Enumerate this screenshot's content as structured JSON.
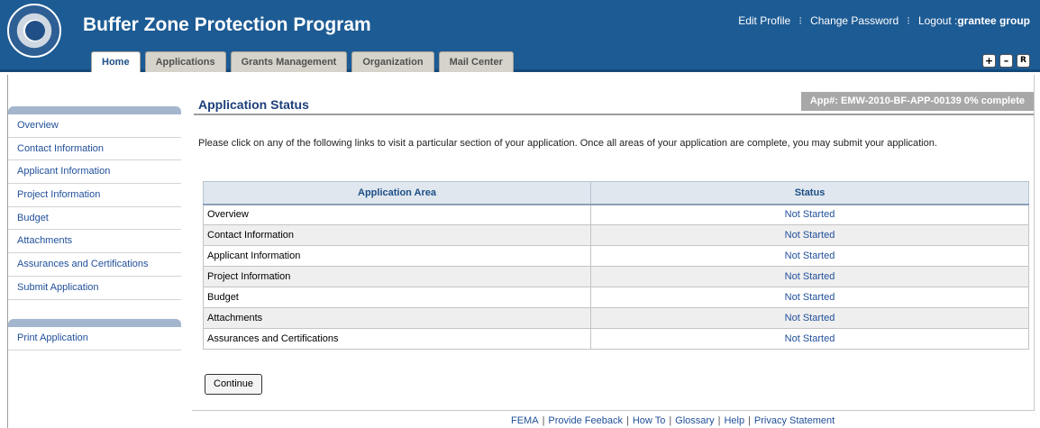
{
  "header": {
    "title": "Buffer Zone Protection Program",
    "links": {
      "edit_profile": "Edit Profile",
      "change_password": "Change Password",
      "logout_prefix": "Logout :",
      "user": "grantee group",
      "separator": "⁝"
    },
    "tabs": [
      {
        "label": "Home",
        "active": true
      },
      {
        "label": "Applications",
        "active": false
      },
      {
        "label": "Grants Management",
        "active": false
      },
      {
        "label": "Organization",
        "active": false
      },
      {
        "label": "Mail Center",
        "active": false
      }
    ],
    "font_controls": {
      "increase": "+",
      "decrease": "–",
      "reset": "R"
    }
  },
  "sidebar": {
    "items": [
      {
        "label": "Overview"
      },
      {
        "label": "Contact Information"
      },
      {
        "label": "Applicant Information"
      },
      {
        "label": "Project Information"
      },
      {
        "label": "Budget"
      },
      {
        "label": "Attachments"
      },
      {
        "label": "Assurances and Certifications"
      },
      {
        "label": "Submit Application"
      }
    ],
    "secondary_items": [
      {
        "label": "Print Application"
      }
    ]
  },
  "main": {
    "title": "Application Status",
    "app_badge": "App#: EMW-2010-BF-APP-00139 0% complete",
    "intro": "Please click on any of the following links to visit a particular section of your application. Once all areas of your application are complete, you may submit your application.",
    "table": {
      "headers": [
        "Application Area",
        "Status"
      ],
      "rows": [
        {
          "area": "Overview",
          "status": "Not Started"
        },
        {
          "area": "Contact Information",
          "status": "Not Started"
        },
        {
          "area": "Applicant Information",
          "status": "Not Started"
        },
        {
          "area": "Project Information",
          "status": "Not Started"
        },
        {
          "area": "Budget",
          "status": "Not Started"
        },
        {
          "area": "Attachments",
          "status": "Not Started"
        },
        {
          "area": "Assurances and Certifications",
          "status": "Not Started"
        }
      ]
    },
    "continue_label": "Continue"
  },
  "footer": {
    "links": [
      "FEMA",
      "Provide Feeback",
      "How To",
      "Glossary",
      "Help",
      "Privacy Statement"
    ],
    "separator": "|"
  },
  "colors": {
    "header_bg": "#1d5b94",
    "link": "#21509a",
    "title": "#1d3f7a",
    "badge_bg": "#a8a8a8"
  }
}
